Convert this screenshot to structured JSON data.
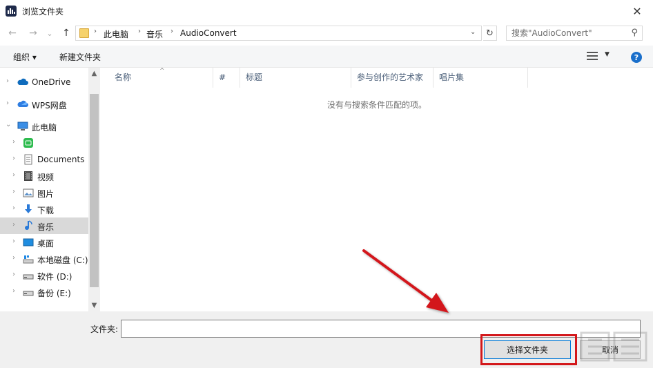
{
  "window": {
    "title": "浏览文件夹",
    "close_glyph": "✕"
  },
  "nav": {
    "back_glyph": "←",
    "forward_glyph": "→",
    "recent_glyph": "⌄",
    "up_glyph": "↑",
    "breadcrumb": [
      "此电脑",
      "音乐",
      "AudioConvert"
    ],
    "crumb_sep": "›",
    "refresh_glyph": "↻",
    "search_placeholder": "搜索\"AudioConvert\"",
    "search_glyph": "⚲"
  },
  "toolbar": {
    "organize_label": "组织 ▾",
    "new_folder_label": "新建文件夹",
    "view_dd_glyph": "▼",
    "help_glyph": "?"
  },
  "sidebar": {
    "items": [
      {
        "label": "OneDrive",
        "icon": "cloud-icon"
      },
      {
        "label": "WPS网盘",
        "icon": "wps-cloud-icon"
      },
      {
        "label": "此电脑",
        "icon": "computer-icon"
      },
      {
        "label": "",
        "icon": "green-app-icon"
      },
      {
        "label": "Documents",
        "icon": "document-icon"
      },
      {
        "label": "视频",
        "icon": "video-icon"
      },
      {
        "label": "图片",
        "icon": "picture-icon"
      },
      {
        "label": "下载",
        "icon": "download-icon"
      },
      {
        "label": "音乐",
        "icon": "music-icon",
        "selected": true
      },
      {
        "label": "桌面",
        "icon": "desktop-icon"
      },
      {
        "label": "本地磁盘 (C:)",
        "icon": "drive-c-icon"
      },
      {
        "label": "软件 (D:)",
        "icon": "drive-icon"
      },
      {
        "label": "备份 (E:)",
        "icon": "drive-icon"
      }
    ],
    "chev_right": "›",
    "chev_down": "⌄"
  },
  "content": {
    "columns": [
      "名称",
      "#",
      "标题",
      "参与创作的艺术家",
      "唱片集"
    ],
    "sort_glyph": "^",
    "empty_message": "没有与搜索条件匹配的项。"
  },
  "footer": {
    "folder_label": "文件夹:",
    "folder_value": "",
    "select_label": "选择文件夹",
    "cancel_label": "取消"
  },
  "colors": {
    "accent": "#0078d7",
    "annotation_red": "#d3171a",
    "selected_bg": "#d9d9d9"
  }
}
